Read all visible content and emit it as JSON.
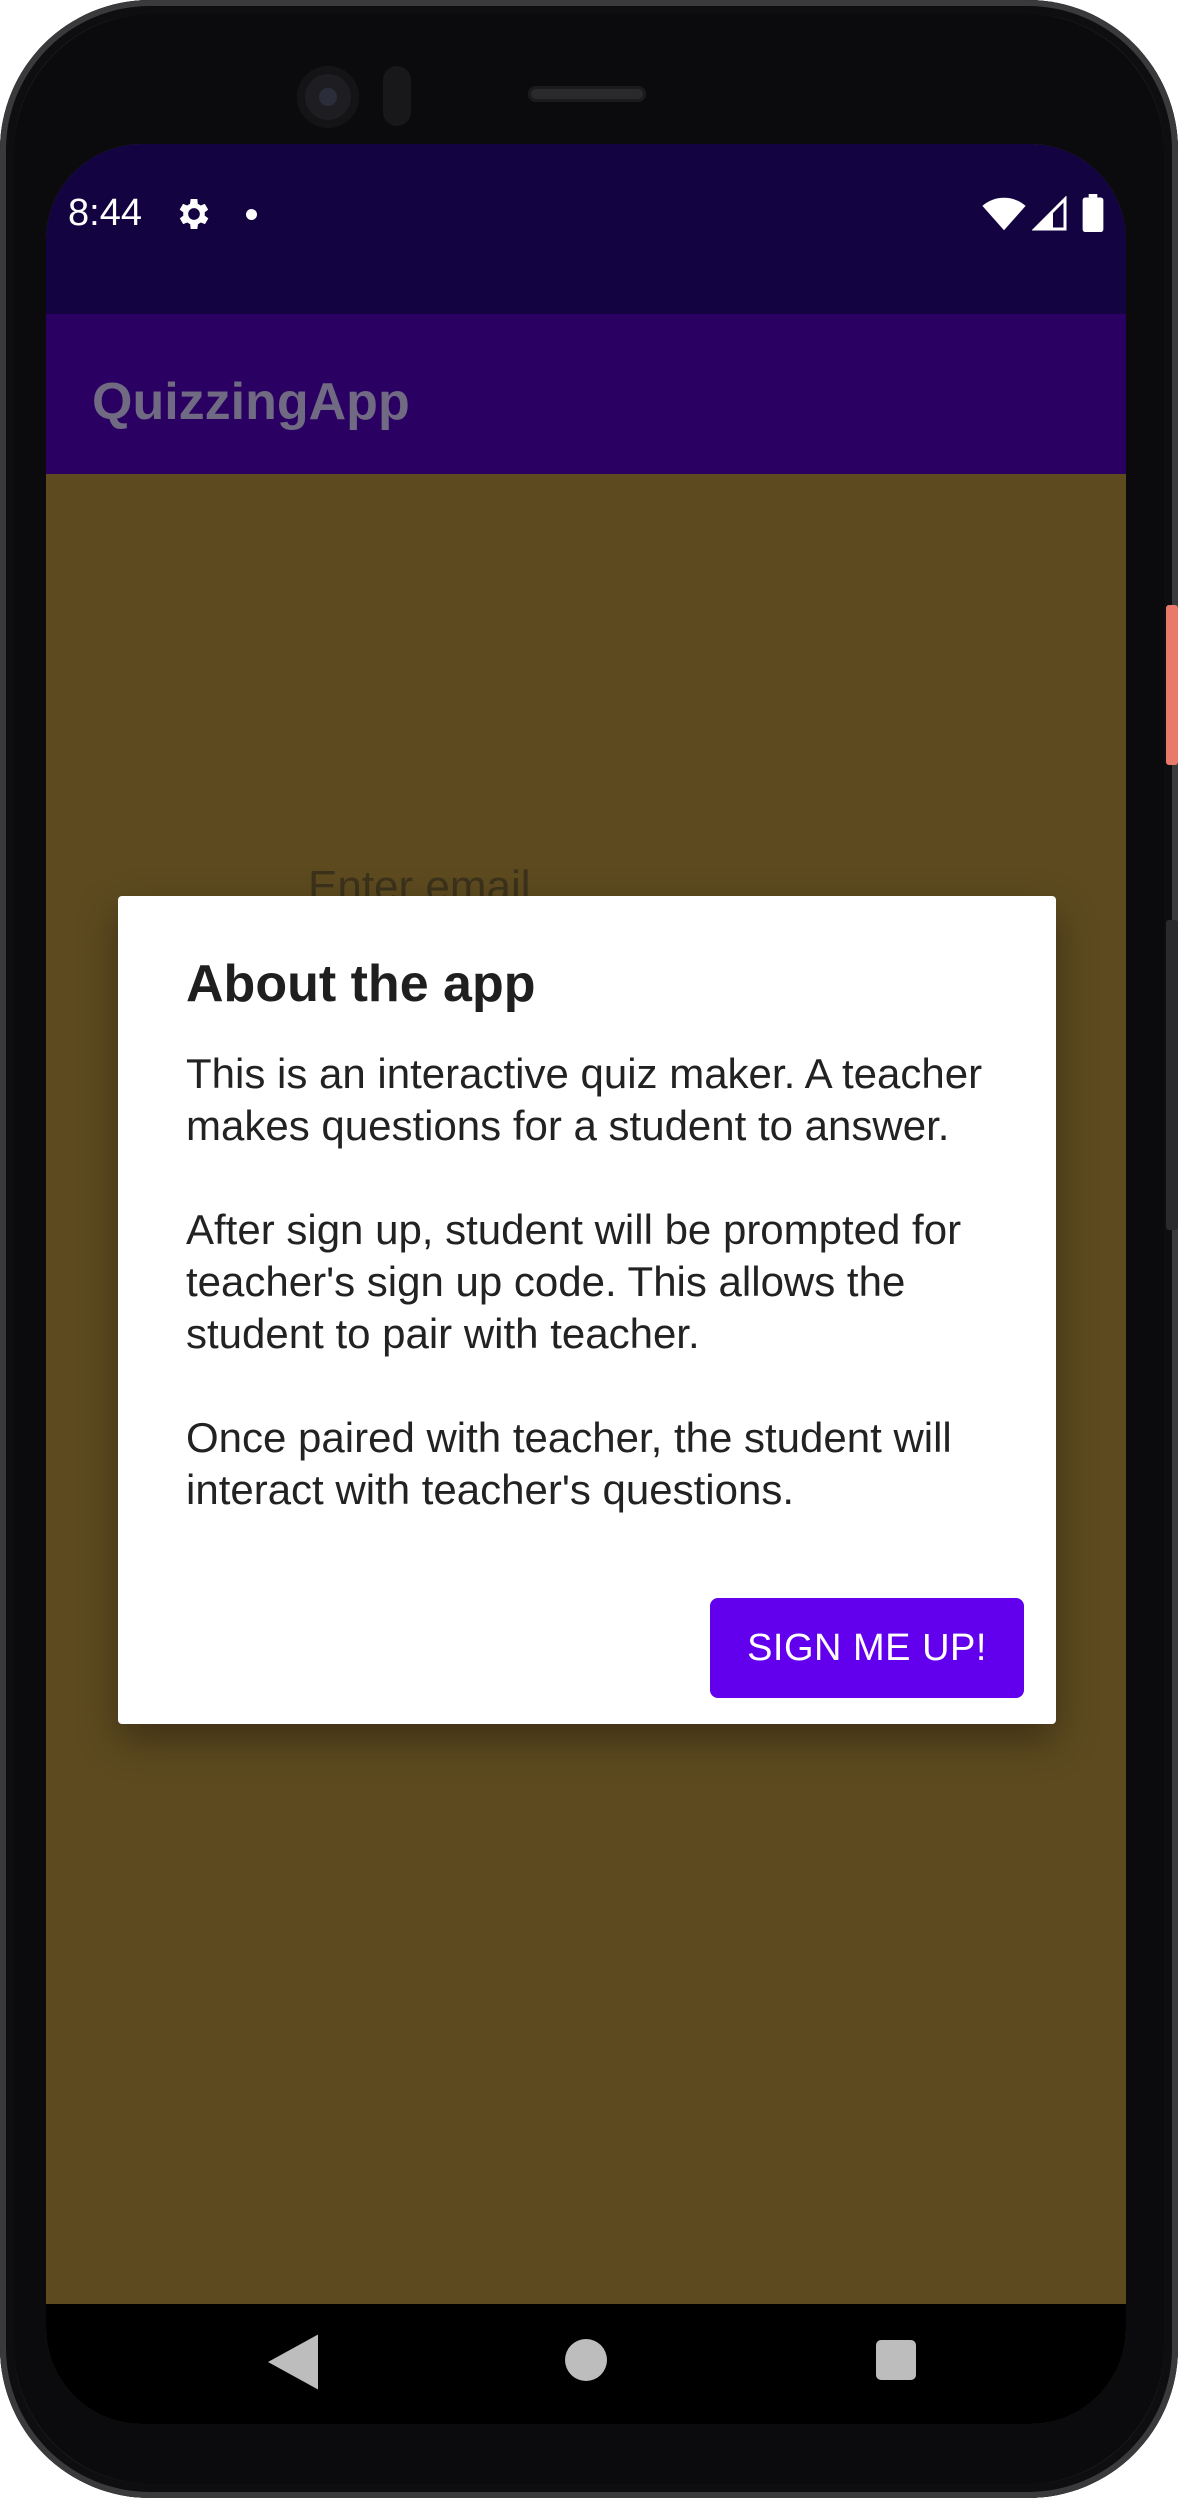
{
  "status_bar": {
    "time": "8:44",
    "icons": [
      "gear-icon",
      "notification-dot-icon",
      "wifi-icon",
      "signal-icon",
      "battery-icon"
    ]
  },
  "app_bar": {
    "title": "QuizzingApp"
  },
  "content": {
    "email_placeholder": "Enter email"
  },
  "dialog": {
    "title": "About the app",
    "message": "This is an interactive quiz maker. A teacher makes questions for a student to answer.\n\nAfter sign up, student will be prompted for teacher's sign up code. This allows the student to pair with teacher.\n\nOnce paired with teacher, the student will interact with teacher's questions.",
    "button_label": "SIGN ME UP!"
  },
  "nav_bar": {
    "icons": [
      "back-icon",
      "home-icon",
      "recents-icon"
    ]
  },
  "colors": {
    "status_bar": "#130341",
    "app_bar": "#2a0063",
    "scrim_background": "#5d4a1f",
    "button_accent": "#6200ee"
  }
}
